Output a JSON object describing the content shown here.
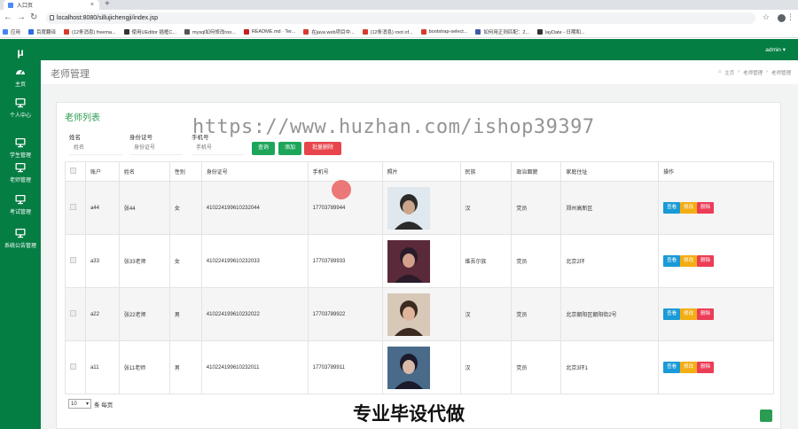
{
  "browser": {
    "tab_title": "入口页",
    "new_tab": "+",
    "url": "localhost:8080/sillujichengji/index.jsp",
    "bookmarks": [
      {
        "label": "应用",
        "color": "#4285f4"
      },
      {
        "label": "百度翻译",
        "color": "#2d6be3"
      },
      {
        "label": "(12条消息) freema...",
        "color": "#d83b2e"
      },
      {
        "label": "使用UEditor 插框C...",
        "color": "#333333"
      },
      {
        "label": "mysql如何修改roo...",
        "color": "#555555"
      },
      {
        "label": "README.md · Ter...",
        "color": "#c71d23"
      },
      {
        "label": "在java web项目中...",
        "color": "#d83b2e"
      },
      {
        "label": "(12条消息) root of...",
        "color": "#d83b2e"
      },
      {
        "label": "bootstrap-select...",
        "color": "#d83b2e"
      },
      {
        "label": "如何用正则匹配：2...",
        "color": "#3b5ba5"
      },
      {
        "label": "layDate - 日期和...",
        "color": "#333333"
      }
    ]
  },
  "app": {
    "logo": "μ",
    "user": "admin ▾",
    "page_title": "老师管理",
    "breadcrumb": [
      "主页",
      "›",
      "老师管理",
      "›",
      "老师管理"
    ],
    "sidebar": [
      {
        "label": "主页",
        "icon": "dashboard-icon"
      },
      {
        "label": "个人中心",
        "icon": "monitor-icon"
      },
      {
        "label": "学生管理",
        "icon": "monitor-icon"
      },
      {
        "label": "老师管理",
        "icon": "monitor-icon"
      },
      {
        "label": "考试管理",
        "icon": "monitor-icon"
      },
      {
        "label": "系统公告管理",
        "icon": "monitor-icon"
      }
    ]
  },
  "list": {
    "title": "老师列表",
    "search": {
      "name_label": "姓名",
      "name_placeholder": "姓名",
      "idcard_label": "身份证号",
      "idcard_placeholder": "身份证号",
      "phone_label": "手机号",
      "phone_placeholder": "手机号",
      "query_btn": "查询",
      "add_btn": "添加",
      "batch_delete_btn": "批量删除"
    },
    "columns": [
      "账户",
      "姓名",
      "性别",
      "身份证号",
      "手机号",
      "照片",
      "民族",
      "政治面貌",
      "家庭住址",
      "操作"
    ],
    "rows": [
      {
        "account": "a44",
        "name": "张44",
        "gender": "女",
        "idcard": "410224199610232044",
        "phone": "17703789944",
        "ethnic": "汉",
        "political": "党员",
        "address": "郑州高新区"
      },
      {
        "account": "a33",
        "name": "张33老师",
        "gender": "女",
        "idcard": "410224199610232033",
        "phone": "17703789933",
        "ethnic": "维吾尔族",
        "political": "党员",
        "address": "北京2环"
      },
      {
        "account": "a22",
        "name": "张22老师",
        "gender": "男",
        "idcard": "410224199610232022",
        "phone": "17703789922",
        "ethnic": "汉",
        "political": "党员",
        "address": "北京朝阳区朝阳街2号"
      },
      {
        "account": "a11",
        "name": "张11老师",
        "gender": "男",
        "idcard": "410224199610232011",
        "phone": "17703789911",
        "ethnic": "汉",
        "political": "党员",
        "address": "北京3环1"
      }
    ],
    "actions": {
      "view": "查看",
      "edit": "修改",
      "delete": "删除"
    },
    "pager": {
      "page_size": "10",
      "suffix": "条 每页"
    }
  },
  "overlay": {
    "watermark": "https://www.huzhan.com/ishop39397",
    "banner": "专业毕设代做"
  },
  "colors": {
    "brand_green": "#057e44",
    "accent_green": "#1da55a",
    "danger": "#e8444c",
    "view_blue": "#1a9ad6",
    "edit_yellow": "#f3ae15",
    "delete_red": "#ec3d57"
  }
}
